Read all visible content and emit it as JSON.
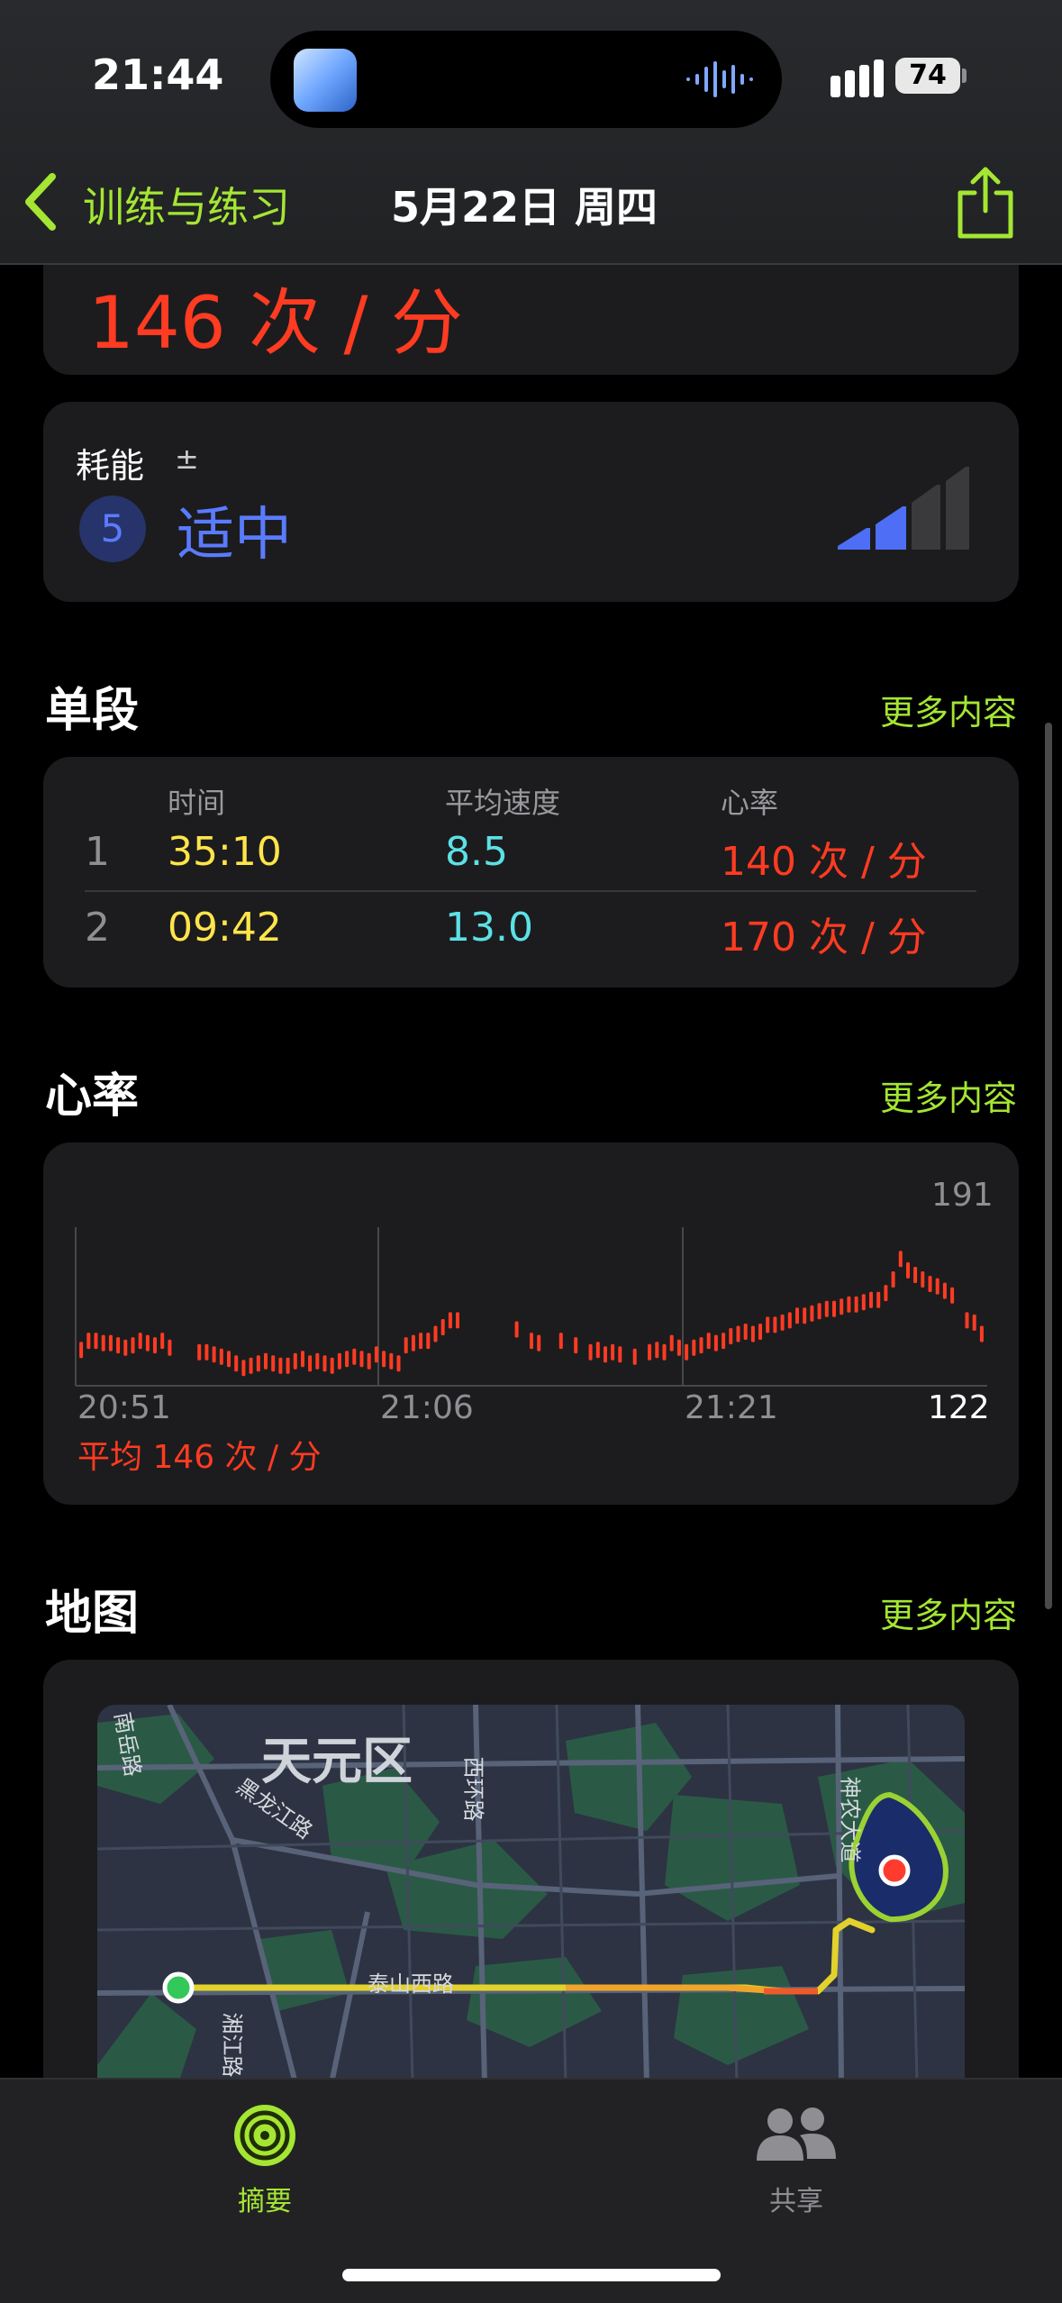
{
  "status_bar": {
    "time": "21:44",
    "battery": "74"
  },
  "nav": {
    "back_label": "训练与练习",
    "title": "5月22日 周四"
  },
  "heart_rate_summary": {
    "value": "146 次 / 分"
  },
  "effort": {
    "label": "耗能",
    "adjust_symbol": "±",
    "level": "5",
    "level_text": "适中",
    "level_color": "#5a7bff",
    "filled_bars": 2,
    "total_bars": 4
  },
  "splits": {
    "title": "单段",
    "more": "更多内容",
    "headers": {
      "time": "时间",
      "speed": "平均速度",
      "hr": "心率"
    },
    "rows": [
      {
        "n": "1",
        "time": "35:10",
        "speed": "8.5",
        "hr": "140 次 / 分"
      },
      {
        "n": "2",
        "time": "09:42",
        "speed": "13.0",
        "hr": "170 次 / 分"
      }
    ]
  },
  "heart_rate": {
    "title": "心率",
    "more": "更多内容",
    "max": "191",
    "min": "122",
    "x_ticks": [
      "20:51",
      "21:06",
      "21:21"
    ],
    "average": "平均 146 次 / 分",
    "color": "#ff3b22"
  },
  "chart_data": {
    "type": "bar",
    "title": "心率",
    "ylim": [
      122,
      191
    ],
    "x_ticks": [
      "20:51",
      "21:06",
      "21:21"
    ],
    "values": [
      137,
      141,
      141,
      140,
      140,
      139,
      138,
      139,
      141,
      140,
      139,
      141,
      138,
      null,
      null,
      null,
      136,
      136,
      135,
      134,
      133,
      131,
      129,
      130,
      131,
      132,
      131,
      130,
      130,
      132,
      133,
      131,
      132,
      131,
      130,
      132,
      133,
      134,
      133,
      132,
      135,
      133,
      132,
      131,
      139,
      140,
      141,
      141,
      144,
      147,
      150,
      150,
      null,
      null,
      null,
      null,
      null,
      null,
      null,
      146,
      null,
      141,
      140,
      null,
      null,
      141,
      null,
      139,
      null,
      136,
      137,
      135,
      136,
      135,
      null,
      134,
      null,
      136,
      137,
      136,
      140,
      138,
      136,
      138,
      139,
      141,
      140,
      141,
      143,
      144,
      145,
      144,
      145,
      148,
      148,
      149,
      150,
      152,
      152,
      153,
      154,
      155,
      155,
      156,
      157,
      157,
      158,
      159,
      159,
      162,
      168,
      177,
      172,
      170,
      168,
      166,
      165,
      163,
      161,
      null,
      150,
      149,
      144
    ]
  },
  "map": {
    "title": "地图",
    "more": "更多内容",
    "district": "天元区",
    "roads": [
      "黑龙江路",
      "西环路",
      "泰山西路",
      "神农大道",
      "南岳路",
      "湘江路"
    ]
  },
  "tabs": [
    {
      "label": "摘要",
      "active": true
    },
    {
      "label": "共享",
      "active": false
    }
  ],
  "accent": "#a4e633"
}
